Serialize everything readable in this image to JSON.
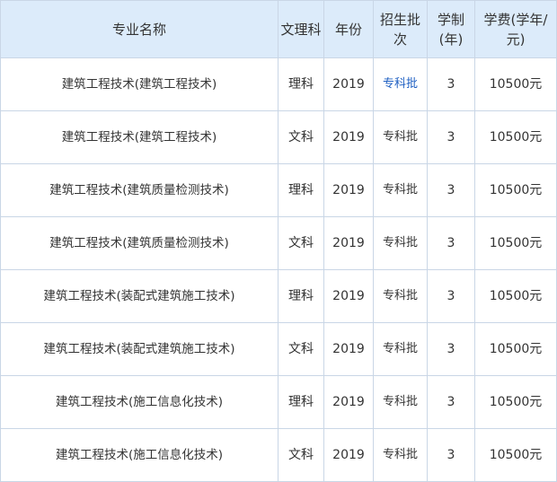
{
  "table": {
    "headers": [
      "专业名称",
      "文理科",
      "年份",
      "招生批次",
      "学制(年)",
      "学费(学年/元)"
    ],
    "rows": [
      {
        "major": "建筑工程技术(建筑工程技术)",
        "track": "理科",
        "year": "2019",
        "batch": "专科批",
        "years": "3",
        "fee": "10500元"
      },
      {
        "major": "建筑工程技术(建筑工程技术)",
        "track": "文科",
        "year": "2019",
        "batch": "专科批",
        "years": "3",
        "fee": "10500元"
      },
      {
        "major": "建筑工程技术(建筑质量检测技术)",
        "track": "理科",
        "year": "2019",
        "batch": "专科批",
        "years": "3",
        "fee": "10500元"
      },
      {
        "major": "建筑工程技术(建筑质量检测技术)",
        "track": "文科",
        "year": "2019",
        "batch": "专科批",
        "years": "3",
        "fee": "10500元"
      },
      {
        "major": "建筑工程技术(装配式建筑施工技术)",
        "track": "理科",
        "year": "2019",
        "batch": "专科批",
        "years": "3",
        "fee": "10500元"
      },
      {
        "major": "建筑工程技术(装配式建筑施工技术)",
        "track": "文科",
        "year": "2019",
        "batch": "专科批",
        "years": "3",
        "fee": "10500元"
      },
      {
        "major": "建筑工程技术(施工信息化技术)",
        "track": "理科",
        "year": "2019",
        "batch": "专科批",
        "years": "3",
        "fee": "10500元"
      },
      {
        "major": "建筑工程技术(施工信息化技术)",
        "track": "文科",
        "year": "2019",
        "batch": "专科批",
        "years": "3",
        "fee": "10500元"
      }
    ]
  },
  "colors": {
    "header_bg": "#dcebfa",
    "border": "#c9d6e6",
    "link": "#1e5fc2"
  }
}
